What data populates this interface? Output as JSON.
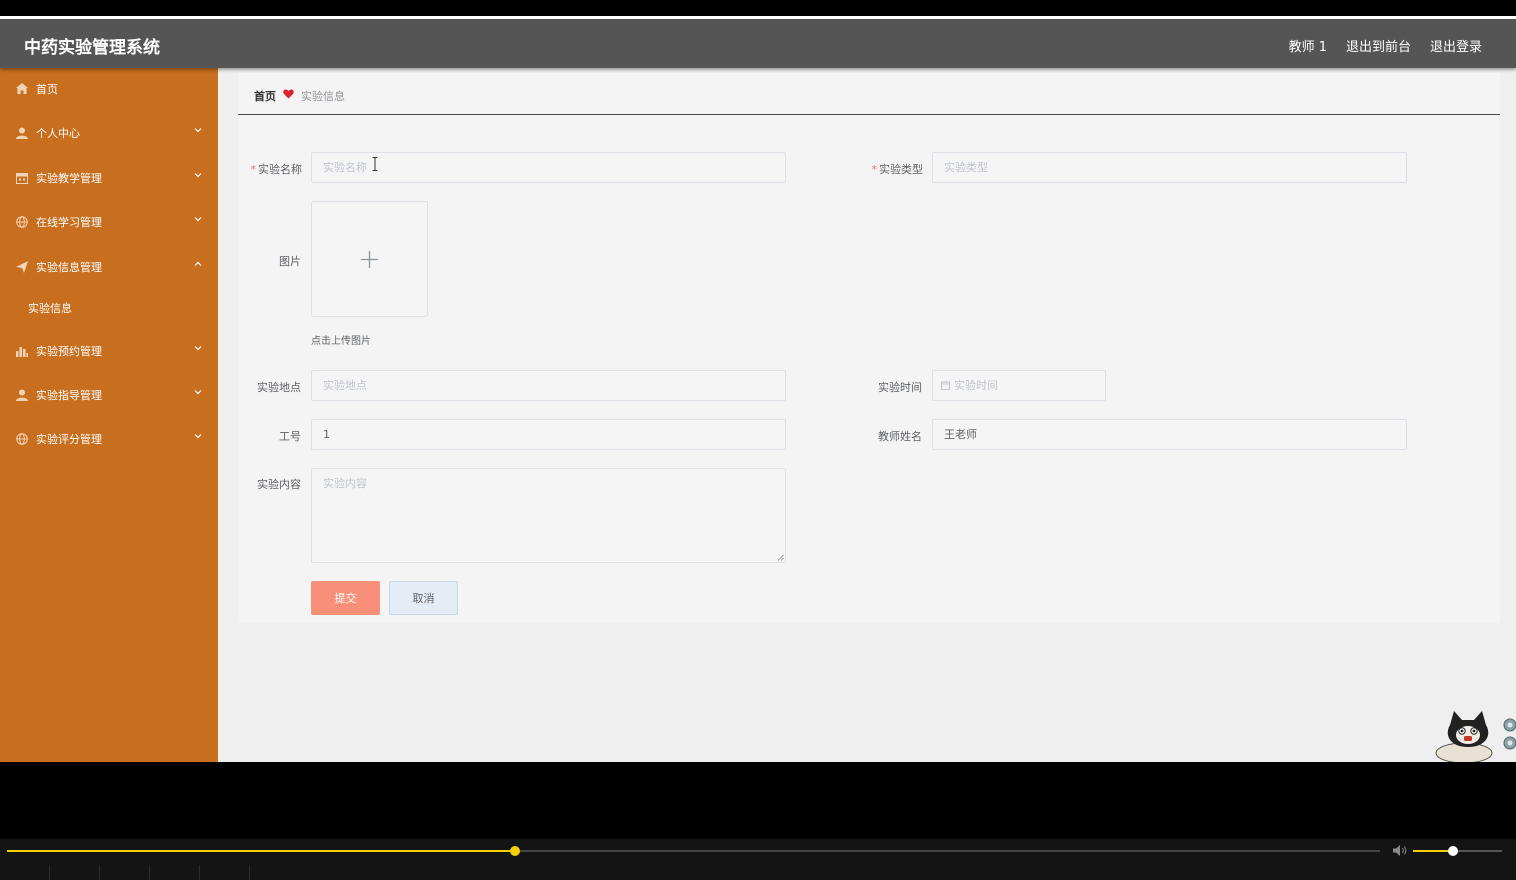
{
  "header": {
    "title": "中药实验管理系统",
    "user": "教师 1",
    "to_front": "退出到前台",
    "logout": "退出登录"
  },
  "sidebar": {
    "items": [
      {
        "label": "首页",
        "icon": "home-icon"
      },
      {
        "label": "个人中心",
        "icon": "user-icon"
      },
      {
        "label": "实验教学管理",
        "icon": "calendar-icon"
      },
      {
        "label": "在线学习管理",
        "icon": "globe-icon"
      },
      {
        "label": "实验信息管理",
        "icon": "send-icon"
      },
      {
        "label": "实验信息",
        "icon": ""
      },
      {
        "label": "实验预约管理",
        "icon": "bar-chart-icon"
      },
      {
        "label": "实验指导管理",
        "icon": "user-icon"
      },
      {
        "label": "实验评分管理",
        "icon": "globe-icon"
      }
    ]
  },
  "breadcrumb": {
    "home": "首页",
    "current": "实验信息"
  },
  "form": {
    "name": {
      "label": "实验名称",
      "placeholder": "实验名称"
    },
    "type": {
      "label": "实验类型",
      "placeholder": "实验类型"
    },
    "image": {
      "label": "图片",
      "hint": "点击上传图片"
    },
    "location": {
      "label": "实验地点",
      "placeholder": "实验地点"
    },
    "time": {
      "label": "实验时间",
      "placeholder": "实验时间"
    },
    "job_no": {
      "label": "工号",
      "value": "1"
    },
    "teacher": {
      "label": "教师姓名",
      "value": "王老师"
    },
    "content": {
      "label": "实验内容",
      "placeholder": "实验内容"
    },
    "submit": "提交",
    "cancel": "取消"
  },
  "colors": {
    "sidebar": "#c86f1f",
    "header": "#555555",
    "submit": "#f88f79",
    "seek": "#f5d000"
  },
  "player": {
    "progress": 0.37,
    "volume": 0.45
  }
}
